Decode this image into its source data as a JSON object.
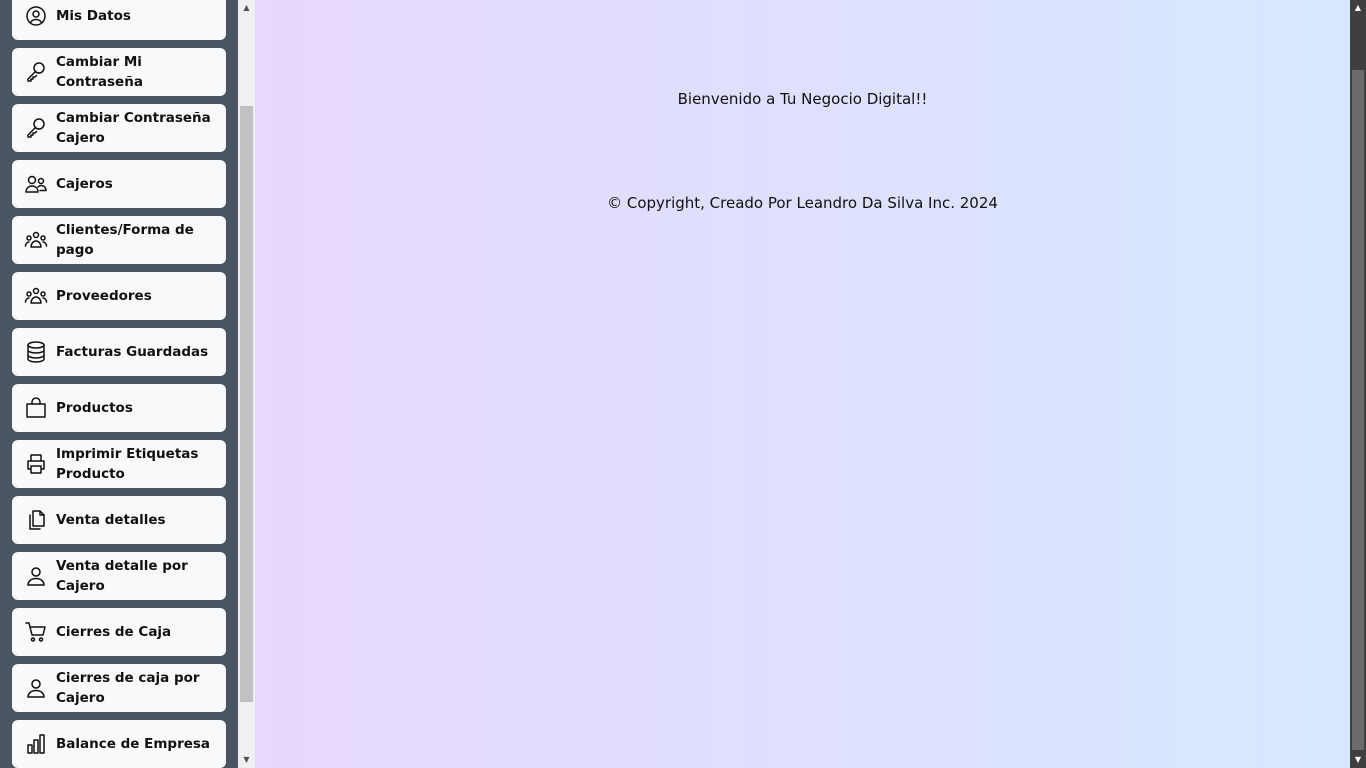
{
  "sidebar": {
    "items": [
      {
        "label": "Mis Datos",
        "icon": "user-circle-icon"
      },
      {
        "label": "Cambiar Mi Contraseña",
        "icon": "key-icon"
      },
      {
        "label": "Cambiar Contraseña Cajero",
        "icon": "key-icon"
      },
      {
        "label": "Cajeros",
        "icon": "users-icon"
      },
      {
        "label": "Clientes/Forma de pago",
        "icon": "people-group-icon"
      },
      {
        "label": "Proveedores",
        "icon": "people-group-icon"
      },
      {
        "label": "Facturas Guardadas",
        "icon": "database-icon"
      },
      {
        "label": "Productos",
        "icon": "shopping-bag-icon"
      },
      {
        "label": "Imprimir Etiquetas Producto",
        "icon": "printer-icon"
      },
      {
        "label": "Venta detalles",
        "icon": "files-icon"
      },
      {
        "label": "Venta detalle por Cajero",
        "icon": "user-icon"
      },
      {
        "label": "Cierres de Caja",
        "icon": "cart-icon"
      },
      {
        "label": "Cierres de caja por Cajero",
        "icon": "user-icon"
      },
      {
        "label": "Balance de Empresa",
        "icon": "bar-chart-icon"
      }
    ]
  },
  "main": {
    "welcome": "Bienvenido a Tu Negocio Digital!!",
    "copyright": "© Copyright, Creado Por Leandro Da Silva Inc. 2024"
  }
}
